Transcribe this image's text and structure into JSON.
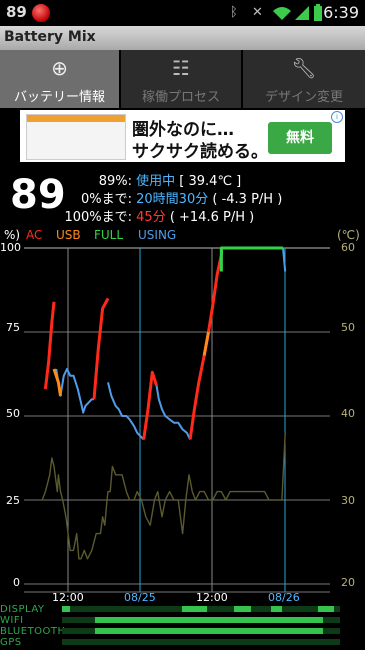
{
  "status_bar": {
    "left_number": "89",
    "time": "6:39"
  },
  "app": {
    "title": "Battery Mix"
  },
  "tabs": [
    {
      "label": "バッテリー情報",
      "icon": "target-icon",
      "active": true
    },
    {
      "label": "稼働プロセス",
      "icon": "process-list-icon",
      "active": false
    },
    {
      "label": "デザイン変更",
      "icon": "wrench-icon",
      "active": false
    }
  ],
  "ad": {
    "line1": "圏外なのに…",
    "line2": "サクサク読める。",
    "button": "無料"
  },
  "battery": {
    "big_percent": "89",
    "row1_key": "89%:",
    "row1_status": "使用中",
    "row1_extra": "[ 39.4℃ ]",
    "row2_key": "0%まで:",
    "row2_time": "20時間30分",
    "row2_extra": "( -4.3 P/H )",
    "row3_key": "100%まで:",
    "row3_time": "45分",
    "row3_extra": "( +14.6 P/H )"
  },
  "legend": {
    "unit_left": "%)",
    "items": [
      {
        "label": "AC",
        "color": "#ff2a1a"
      },
      {
        "label": "USB",
        "color": "#ff8a1a"
      },
      {
        "label": "FULL",
        "color": "#35d247"
      },
      {
        "label": "USING",
        "color": "#4f9de8"
      }
    ],
    "unit_right": "(℃)"
  },
  "colors": {
    "ac": "#ff2a1a",
    "usb": "#ff8a1a",
    "full": "#35d247",
    "using": "#4f9de8",
    "temp": "#5b5a2e",
    "day_line": "#2aa6d8"
  },
  "chart_data": {
    "type": "line",
    "title": "",
    "y_ticks_percent": [
      "100",
      "75",
      "50",
      "25",
      "0"
    ],
    "y_ticks_temp": [
      "60",
      "50",
      "40",
      "30",
      "20"
    ],
    "x_labels": [
      {
        "label": "12:00",
        "day": false
      },
      {
        "label": "08/25",
        "day": true
      },
      {
        "label": "12:00",
        "day": false
      },
      {
        "label": "08/26",
        "day": true
      }
    ],
    "ylim_percent": [
      0,
      100
    ],
    "ylim_temp": [
      20,
      60
    ],
    "series": [
      {
        "name": "USING",
        "segments": [
          [
            [
              0.15,
              64
            ],
            [
              0.19,
              56
            ],
            [
              0.22,
              62
            ],
            [
              0.25,
              64
            ],
            [
              0.28,
              62
            ],
            [
              0.31,
              62
            ],
            [
              0.35,
              58
            ],
            [
              0.38,
              54
            ],
            [
              0.4,
              51
            ],
            [
              0.42,
              53
            ],
            [
              0.45,
              54
            ],
            [
              0.48,
              55
            ],
            [
              0.5,
              55
            ]
          ],
          [
            [
              0.63,
              60
            ],
            [
              0.66,
              56
            ],
            [
              0.7,
              53
            ],
            [
              0.73,
              52
            ],
            [
              0.76,
              50
            ],
            [
              0.8,
              50
            ],
            [
              0.83,
              49
            ],
            [
              0.87,
              47
            ],
            [
              0.9,
              45
            ],
            [
              0.93,
              44
            ],
            [
              0.96,
              43
            ]
          ],
          [
            [
              1.08,
              59
            ],
            [
              1.1,
              55
            ],
            [
              1.13,
              52
            ],
            [
              1.16,
              50
            ],
            [
              1.2,
              49
            ],
            [
              1.24,
              48
            ],
            [
              1.28,
              48
            ],
            [
              1.32,
              46
            ],
            [
              1.36,
              45
            ],
            [
              1.39,
              43
            ]
          ],
          [
            [
              2.25,
              100
            ],
            [
              2.27,
              93
            ]
          ]
        ]
      },
      {
        "name": "AC",
        "segments": [
          [
            [
              0.05,
              58
            ],
            [
              0.08,
              66
            ],
            [
              0.11,
              78
            ],
            [
              0.13,
              84
            ]
          ],
          [
            [
              0.5,
              55
            ],
            [
              0.54,
              70
            ],
            [
              0.58,
              82
            ],
            [
              0.63,
              85
            ]
          ],
          [
            [
              0.96,
              43
            ],
            [
              1.0,
              52
            ],
            [
              1.04,
              63
            ],
            [
              1.08,
              59
            ]
          ],
          [
            [
              1.39,
              43
            ],
            [
              1.43,
              52
            ],
            [
              1.47,
              60
            ],
            [
              1.52,
              68
            ],
            [
              1.56,
              75
            ],
            [
              1.6,
              83
            ],
            [
              1.64,
              92
            ],
            [
              1.68,
              98
            ]
          ]
        ]
      },
      {
        "name": "USB",
        "segments": [
          [
            [
              0.13,
              64
            ],
            [
              0.15,
              62
            ],
            [
              0.17,
              60
            ],
            [
              0.19,
              56
            ]
          ],
          [
            [
              1.52,
              68
            ],
            [
              1.56,
              75
            ]
          ]
        ]
      },
      {
        "name": "FULL",
        "segments": [
          [
            [
              1.68,
              98
            ],
            [
              1.68,
              100
            ],
            [
              2.25,
              100
            ]
          ],
          [
            [
              1.68,
              100
            ],
            [
              1.68,
              93
            ]
          ]
        ]
      },
      {
        "name": "TEMP",
        "segments": [
          [
            [
              0.02,
              30
            ],
            [
              0.05,
              31
            ],
            [
              0.07,
              32
            ],
            [
              0.09,
              33
            ],
            [
              0.11,
              35
            ],
            [
              0.13,
              34
            ],
            [
              0.15,
              32
            ],
            [
              0.16,
              31
            ],
            [
              0.17,
              33
            ],
            [
              0.19,
              31
            ],
            [
              0.21,
              30
            ],
            [
              0.24,
              28
            ],
            [
              0.26,
              26
            ],
            [
              0.28,
              24
            ],
            [
              0.31,
              24
            ],
            [
              0.34,
              26
            ],
            [
              0.36,
              23
            ],
            [
              0.38,
              23
            ],
            [
              0.41,
              24
            ],
            [
              0.44,
              23
            ],
            [
              0.48,
              24
            ],
            [
              0.52,
              26
            ],
            [
              0.56,
              26
            ],
            [
              0.58,
              28
            ],
            [
              0.6,
              27
            ],
            [
              0.62,
              30
            ],
            [
              0.63,
              31
            ],
            [
              0.65,
              31
            ],
            [
              0.67,
              34
            ],
            [
              0.7,
              33
            ],
            [
              0.73,
              33
            ],
            [
              0.76,
              33
            ],
            [
              0.8,
              31
            ],
            [
              0.83,
              30
            ],
            [
              0.87,
              30
            ],
            [
              0.9,
              31
            ],
            [
              0.94,
              30
            ],
            [
              0.98,
              28
            ],
            [
              1.02,
              27
            ],
            [
              1.06,
              30
            ],
            [
              1.09,
              31
            ],
            [
              1.13,
              28
            ],
            [
              1.16,
              30
            ],
            [
              1.2,
              31
            ],
            [
              1.24,
              30
            ],
            [
              1.28,
              30
            ],
            [
              1.32,
              26
            ],
            [
              1.35,
              30
            ],
            [
              1.38,
              33
            ],
            [
              1.41,
              31
            ],
            [
              1.44,
              30
            ],
            [
              1.48,
              31
            ],
            [
              1.52,
              31
            ],
            [
              1.56,
              30
            ],
            [
              1.6,
              30
            ],
            [
              1.64,
              31
            ],
            [
              1.68,
              31
            ],
            [
              1.72,
              30
            ],
            [
              1.76,
              31
            ],
            [
              1.8,
              31
            ],
            [
              1.84,
              31
            ],
            [
              1.88,
              31
            ],
            [
              1.92,
              31
            ],
            [
              1.96,
              31
            ],
            [
              2.0,
              31
            ],
            [
              2.04,
              31
            ],
            [
              2.08,
              31
            ],
            [
              2.12,
              30
            ],
            [
              2.16,
              30
            ],
            [
              2.2,
              30
            ],
            [
              2.24,
              30
            ],
            [
              2.27,
              38
            ]
          ]
        ]
      }
    ]
  },
  "usage_rows": [
    {
      "label": "DISPLAY",
      "segments": [
        [
          0.0,
          0.03
        ],
        [
          0.43,
          0.52
        ],
        [
          0.62,
          0.68
        ],
        [
          0.75,
          0.79
        ],
        [
          0.92,
          0.98
        ]
      ]
    },
    {
      "label": "WIFI",
      "segments": [
        [
          0.12,
          0.94
        ]
      ]
    },
    {
      "label": "BLUETOOTH",
      "segments": [
        [
          0.12,
          0.94
        ]
      ]
    },
    {
      "label": "GPS",
      "segments": []
    }
  ]
}
